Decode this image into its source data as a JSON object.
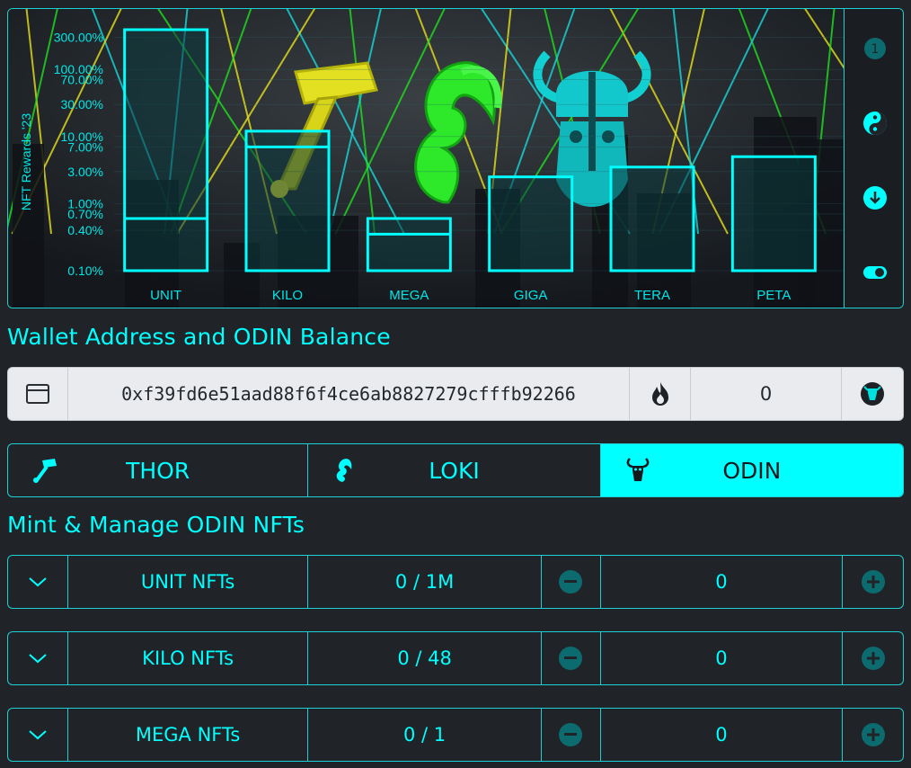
{
  "chart_data": {
    "type": "bar",
    "ylabel": "NFT Rewards '23",
    "yscale": "log",
    "ylim": [
      0.1,
      500
    ],
    "yticks": [
      "0.10%",
      "0.40%",
      "0.70%",
      "1.00%",
      "3.00%",
      "7.00%",
      "10.00%",
      "30.00%",
      "70.00%",
      "100.00%",
      "300.00%"
    ],
    "ytick_values": [
      0.1,
      0.4,
      0.7,
      1,
      3,
      7,
      10,
      30,
      70,
      100,
      300
    ],
    "categories": [
      "UNIT",
      "KILO",
      "MEGA",
      "GIGA",
      "TERA",
      "PETA"
    ],
    "values": [
      400,
      12,
      0.6,
      2.5,
      3.5,
      5
    ],
    "inner_values": [
      0.6,
      7,
      0.35,
      null,
      null,
      null
    ],
    "bar_color": "#00ffff"
  },
  "side_tools": [
    {
      "name": "info-icon"
    },
    {
      "name": "yin-yang-icon"
    },
    {
      "name": "download-icon"
    },
    {
      "name": "toggle-icon"
    }
  ],
  "wallet": {
    "title": "Wallet Address and ODIN Balance",
    "address": "0xf39fd6e51aad88f6f4ce6ab8827279cfffb92266",
    "balance": "0",
    "icons": [
      "wallet-icon",
      "fire-icon",
      "odin-token-icon"
    ]
  },
  "tabs": [
    {
      "label": "THOR",
      "icon": "hammer-icon",
      "active": false
    },
    {
      "label": "LOKI",
      "icon": "loki-helmet-icon",
      "active": false
    },
    {
      "label": "ODIN",
      "icon": "odin-helmet-icon",
      "active": true
    }
  ],
  "manage": {
    "title": "Mint & Manage ODIN NFTs",
    "rows": [
      {
        "label": "UNIT NFTs",
        "supply": "0 / 1M",
        "amount": "0"
      },
      {
        "label": "KILO NFTs",
        "supply": "0 / 48",
        "amount": "0"
      },
      {
        "label": "MEGA NFTs",
        "supply": "0 / 1",
        "amount": "0"
      }
    ]
  },
  "colors": {
    "accent": "#00ffff",
    "background": "#202327",
    "wallet_bar": "#e9ebee",
    "button_dark": "#0c6b6e"
  }
}
